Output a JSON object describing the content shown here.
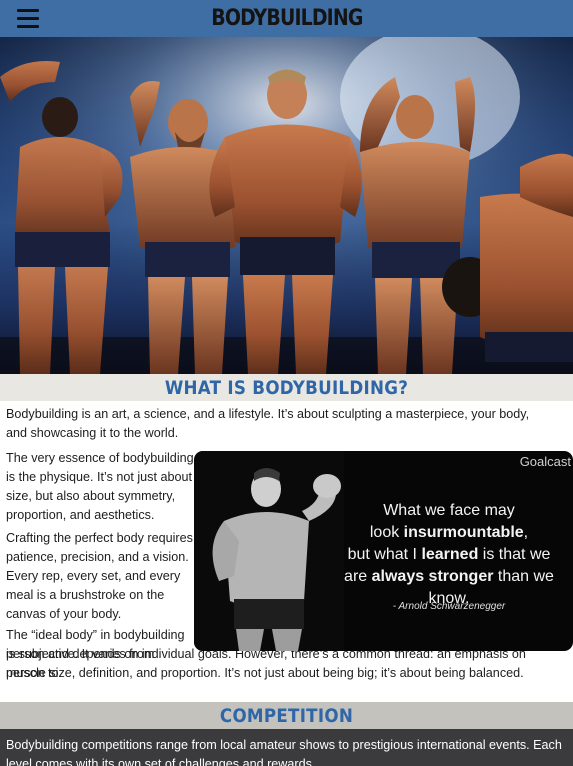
{
  "header": {
    "title": "BODYBUILDING",
    "menu_icon": "hamburger-menu-icon",
    "background_color": "#3f6ea5"
  },
  "hero": {
    "image_desc": "bodybuilders-on-stage"
  },
  "what_is": {
    "heading": "WHAT IS BODYBUILDING?",
    "intro": "Bodybuilding is an art, a science, and a lifestyle. It’s about sculpting a masterpiece, your body, and showcasing it to the world.",
    "para1": "The very essence of bodybuilding is the physique. It’s not just about size, but also about symmetry, proportion, and aesthetics.",
    "para2": "Crafting the perfect body requires patience, precision, and a vision. Every rep, every set, and every meal is a brushstroke on the canvas of your body.",
    "para3_start": "The “ideal body” in bodybuilding is subjective. It varies from person to",
    "para3_end": "person and depends on individual goals. However, there’s a common thread: an emphasis on muscle size, definition, and proportion. It’s not just about being big; it’s about being balanced."
  },
  "quote_card": {
    "brand": "Goalcast",
    "line1": "What we face may",
    "line2_pre": "look ",
    "line2_bold": "insurmountable",
    "line2_post": ",",
    "line3_pre": "but what I ",
    "line3_bold": "learned",
    "line3_post": " is that we",
    "line4_pre": "are ",
    "line4_bold": "always stronger",
    "line4_post": " than we know.",
    "author": "- Arnold Schwarzenegger"
  },
  "competition": {
    "heading": "COMPETITION",
    "text": "Bodybuilding competitions range from local amateur shows to prestigious international events. Each level comes with its own set of challenges and rewards."
  },
  "colors": {
    "accent_blue": "#2f66a7",
    "section_bg": "#e9e7e2",
    "dark_block": "#3b3b3d"
  }
}
